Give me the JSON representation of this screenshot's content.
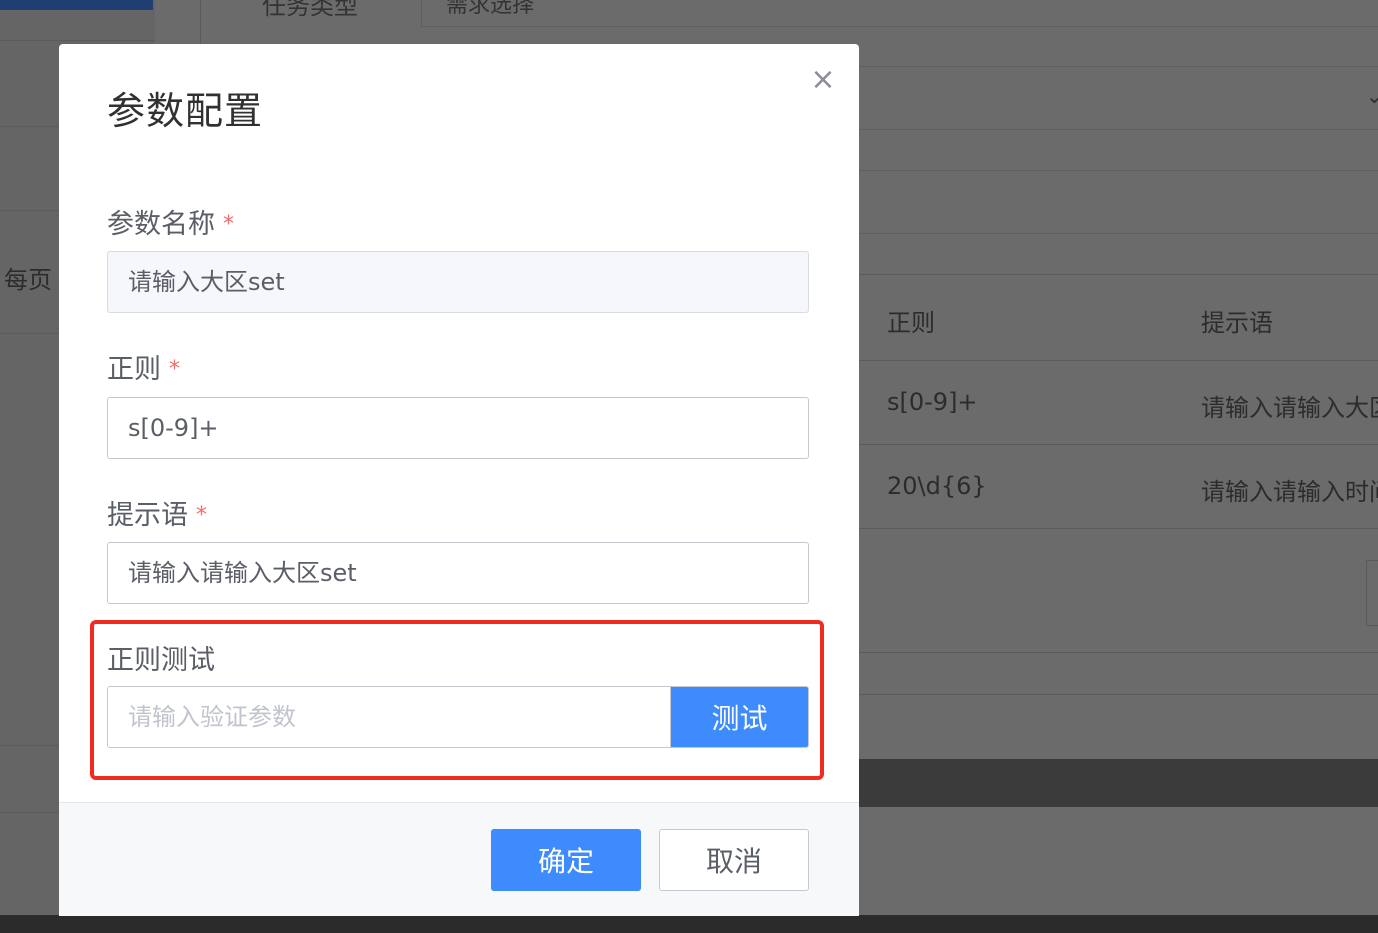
{
  "background": {
    "top_label": "任务类型",
    "top_input_value": "需求选择",
    "per_page_label": "每页",
    "table_headers": [
      "正则",
      "提示语"
    ],
    "table_rows": [
      {
        "regex": "s[0-9]+",
        "hint": "请输入请输入大区"
      },
      {
        "regex": "20\\d{6}",
        "hint": "请输入请输入时间"
      }
    ]
  },
  "modal": {
    "title": "参数配置",
    "close_symbol": "×",
    "fields": {
      "param_name": {
        "label": "参数名称",
        "required_mark": "*",
        "value": "请输入大区set"
      },
      "regex": {
        "label": "正则",
        "required_mark": "*",
        "value": "s[0-9]+"
      },
      "hint": {
        "label": "提示语",
        "required_mark": "*",
        "value": "请输入请输入大区set"
      },
      "regex_test": {
        "label": "正则测试",
        "placeholder": "请输入验证参数",
        "value": "",
        "button_label": "测试"
      }
    },
    "footer": {
      "confirm_label": "确定",
      "cancel_label": "取消"
    }
  },
  "colors": {
    "primary": "#3d8bfd",
    "required": "#f56c6c",
    "highlight": "#f22a1f"
  }
}
